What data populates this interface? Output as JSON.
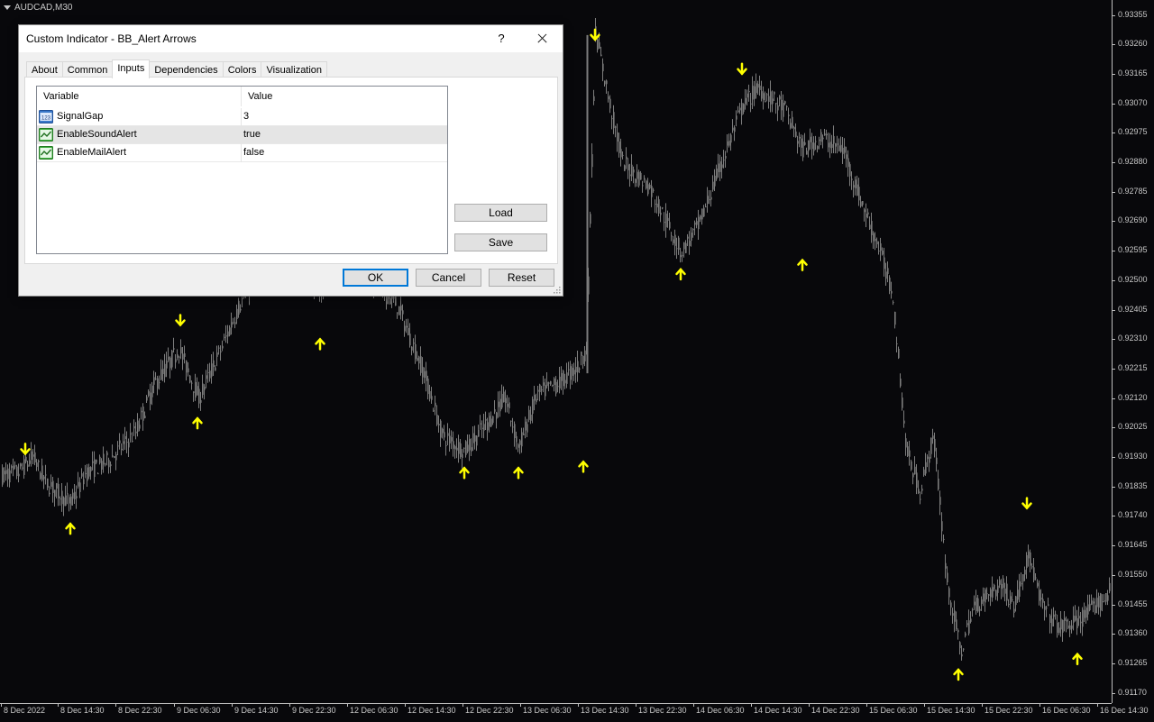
{
  "chart": {
    "symbol": "AUDCAD,M30",
    "price_labels": [
      "0.93355",
      "0.93260",
      "0.93165",
      "0.93070",
      "0.92975",
      "0.92880",
      "0.92785",
      "0.92690",
      "0.92595",
      "0.92500",
      "0.92405",
      "0.92310",
      "0.92215",
      "0.92120",
      "0.92025",
      "0.91930",
      "0.91835",
      "0.91740",
      "0.91645",
      "0.91550",
      "0.91455",
      "0.91360",
      "0.91265",
      "0.91170"
    ],
    "time_labels": [
      "8 Dec 2022",
      "8 Dec 14:30",
      "8 Dec 22:30",
      "9 Dec 06:30",
      "9 Dec 14:30",
      "9 Dec 22:30",
      "12 Dec 06:30",
      "12 Dec 14:30",
      "12 Dec 22:30",
      "13 Dec 06:30",
      "13 Dec 14:30",
      "13 Dec 22:30",
      "14 Dec 06:30",
      "14 Dec 14:30",
      "14 Dec 22:30",
      "15 Dec 06:30",
      "15 Dec 14:30",
      "15 Dec 22:30",
      "16 Dec 06:30",
      "16 Dec 14:30"
    ],
    "colors": {
      "background": "#08080b",
      "candle": "#7d7d7d",
      "axis_text": "#c8c8c8",
      "arrow": "#ffff00"
    }
  },
  "chart_data": {
    "type": "candlestick",
    "instrument": "AUDCAD",
    "timeframe": "M30",
    "ylim": [
      0.9117,
      0.93355
    ],
    "price_path": [
      [
        0,
        0.9187
      ],
      [
        20,
        0.9188
      ],
      [
        36,
        0.9193
      ],
      [
        50,
        0.9185
      ],
      [
        78,
        0.9178
      ],
      [
        95,
        0.9188
      ],
      [
        120,
        0.9192
      ],
      [
        150,
        0.9201
      ],
      [
        170,
        0.9216
      ],
      [
        198,
        0.9228
      ],
      [
        220,
        0.9212
      ],
      [
        245,
        0.9228
      ],
      [
        265,
        0.9242
      ],
      [
        285,
        0.9252
      ],
      [
        300,
        0.9258
      ],
      [
        330,
        0.9255
      ],
      [
        355,
        0.9247
      ],
      [
        380,
        0.9255
      ],
      [
        410,
        0.925
      ],
      [
        440,
        0.9242
      ],
      [
        470,
        0.922
      ],
      [
        490,
        0.92
      ],
      [
        515,
        0.9195
      ],
      [
        540,
        0.9204
      ],
      [
        560,
        0.9212
      ],
      [
        575,
        0.9196
      ],
      [
        595,
        0.9213
      ],
      [
        620,
        0.9217
      ],
      [
        640,
        0.9222
      ],
      [
        650,
        0.9228
      ],
      [
        660,
        0.933
      ],
      [
        675,
        0.9308
      ],
      [
        690,
        0.9288
      ],
      [
        720,
        0.928
      ],
      [
        745,
        0.9265
      ],
      [
        755,
        0.9259
      ],
      [
        775,
        0.9268
      ],
      [
        800,
        0.9288
      ],
      [
        823,
        0.9306
      ],
      [
        840,
        0.9312
      ],
      [
        870,
        0.9305
      ],
      [
        890,
        0.9292
      ],
      [
        910,
        0.9296
      ],
      [
        935,
        0.9292
      ],
      [
        955,
        0.9275
      ],
      [
        975,
        0.926
      ],
      [
        990,
        0.9245
      ],
      [
        1005,
        0.9195
      ],
      [
        1020,
        0.9182
      ],
      [
        1035,
        0.92
      ],
      [
        1050,
        0.9153
      ],
      [
        1065,
        0.913
      ],
      [
        1080,
        0.9145
      ],
      [
        1110,
        0.9152
      ],
      [
        1125,
        0.9145
      ],
      [
        1140,
        0.9162
      ],
      [
        1155,
        0.9145
      ],
      [
        1175,
        0.9138
      ],
      [
        1195,
        0.914
      ],
      [
        1215,
        0.9145
      ],
      [
        1232,
        0.915
      ]
    ],
    "arrows": [
      {
        "dir": "down",
        "x": 28,
        "price": 0.91955
      },
      {
        "dir": "up",
        "x": 78,
        "price": 0.917
      },
      {
        "dir": "down",
        "x": 200,
        "price": 0.9237
      },
      {
        "dir": "up",
        "x": 219,
        "price": 0.9204
      },
      {
        "dir": "up",
        "x": 355,
        "price": 0.92295
      },
      {
        "dir": "up",
        "x": 515,
        "price": 0.9188
      },
      {
        "dir": "up",
        "x": 575,
        "price": 0.9188
      },
      {
        "dir": "up",
        "x": 647,
        "price": 0.919
      },
      {
        "dir": "down",
        "x": 660,
        "price": 0.9329
      },
      {
        "dir": "up",
        "x": 755,
        "price": 0.9252
      },
      {
        "dir": "down",
        "x": 823,
        "price": 0.9318
      },
      {
        "dir": "up",
        "x": 890,
        "price": 0.9255
      },
      {
        "dir": "down",
        "x": 1139,
        "price": 0.9178
      },
      {
        "dir": "up",
        "x": 1063,
        "price": 0.9123
      },
      {
        "dir": "up",
        "x": 1195,
        "price": 0.9128
      }
    ]
  },
  "dialog": {
    "title": "Custom Indicator - BB_Alert Arrows",
    "help_label": "?",
    "tabs": [
      {
        "label": "About",
        "active": false
      },
      {
        "label": "Common",
        "active": false
      },
      {
        "label": "Inputs",
        "active": true
      },
      {
        "label": "Dependencies",
        "active": false
      },
      {
        "label": "Colors",
        "active": false
      },
      {
        "label": "Visualization",
        "active": false
      }
    ],
    "table": {
      "col_variable": "Variable",
      "col_value": "Value",
      "rows": [
        {
          "name": "SignalGap",
          "value": "3",
          "icon": "numeric-icon",
          "selected": false
        },
        {
          "name": "EnableSoundAlert",
          "value": "true",
          "icon": "boolean-icon",
          "selected": true
        },
        {
          "name": "EnableMailAlert",
          "value": "false",
          "icon": "boolean-icon",
          "selected": false
        }
      ]
    },
    "load_label": "Load",
    "save_label": "Save",
    "ok_label": "OK",
    "cancel_label": "Cancel",
    "reset_label": "Reset",
    "numeric_icon_text": "123"
  }
}
